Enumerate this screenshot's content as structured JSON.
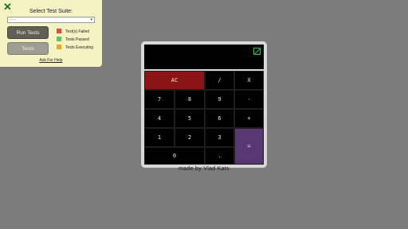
{
  "panel": {
    "title": "Select Test Suite:",
    "select_value": "- - -",
    "run_label": "Run Tests",
    "tests_label": "Tests",
    "legend": [
      {
        "label": "Test(s) Failed",
        "color": "#e04b3a"
      },
      {
        "label": "Tests Passed",
        "color": "#5cc85c"
      },
      {
        "label": "Tests Executing",
        "color": "#f0a81a"
      }
    ],
    "help_label": "Ask For Help"
  },
  "calculator": {
    "display_value": "",
    "keys": {
      "ac": "AC",
      "divide": "/",
      "multiply": "X",
      "seven": "7",
      "eight": "8",
      "nine": "9",
      "minus": "-",
      "four": "4",
      "five": "5",
      "six": "6",
      "plus": "+",
      "one": "1",
      "two": "2",
      "three": "3",
      "equals": "=",
      "zero": "0",
      "decimal": "."
    },
    "colors": {
      "ac": "#8b1515",
      "equals": "#593773",
      "display_icon": "#2bb15a"
    }
  },
  "credit": "made by Vlad Kats"
}
